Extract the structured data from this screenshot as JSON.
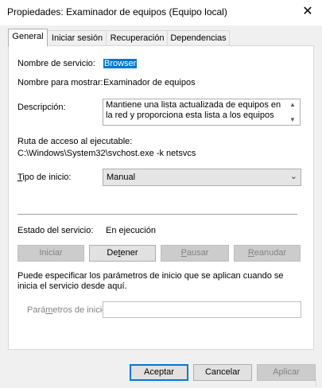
{
  "window": {
    "title": "Propiedades: Examinador de equipos (Equipo local)",
    "close_glyph": "✕"
  },
  "tabs": [
    {
      "label": "General",
      "active": true
    },
    {
      "label": "Iniciar sesión",
      "active": false
    },
    {
      "label": "Recuperación",
      "active": false
    },
    {
      "label": "Dependencias",
      "active": false
    }
  ],
  "general": {
    "service_name_label": "Nombre de servicio:",
    "service_name_value": "Browser",
    "display_name_label": "Nombre para mostrar:",
    "display_name_value": "Examinador de equipos",
    "description_label": "Descripción:",
    "description_value": "Mantiene una lista actualizada de equipos en la red y proporciona esta lista a los equipos",
    "exe_path_label": "Ruta de acceso al ejecutable:",
    "exe_path_value": "C:\\Windows\\System32\\svchost.exe -k netsvcs",
    "startup_type_label_underlined": "T",
    "startup_type_label_rest": "ipo de inicio:",
    "startup_type_value": "Manual",
    "service_status_label": "Estado del servicio:",
    "service_status_value": "En ejecución",
    "buttons": {
      "start": "Iniciar",
      "stop_pre": "De",
      "stop_u": "t",
      "stop_post": "ener",
      "pause_u": "P",
      "pause_post": "ausar",
      "resume_u": "R",
      "resume_post": "eanudar"
    },
    "params_note": "Puede especificar los parámetros de inicio que se aplican cuando se inicia el servicio desde aquí.",
    "params_label_pre": "Pará",
    "params_label_u": "m",
    "params_label_post": "etros de inicio:",
    "params_value": ""
  },
  "footer": {
    "ok": "Aceptar",
    "cancel": "Cancelar",
    "apply": "Aplicar"
  }
}
